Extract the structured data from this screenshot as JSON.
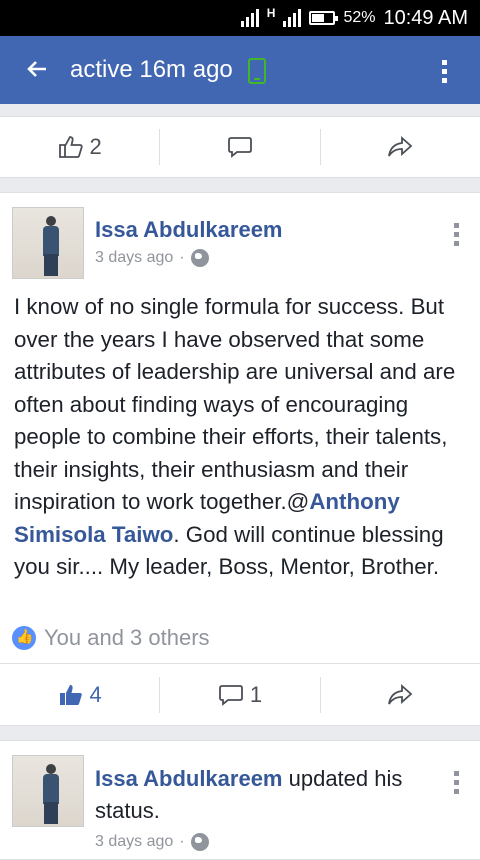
{
  "status_bar": {
    "network": "H",
    "battery": "52%",
    "time": "10:49 AM"
  },
  "app_bar": {
    "title": "active 16m ago"
  },
  "post1": {
    "like_count": "2"
  },
  "post2": {
    "author": "Issa Abdulkareem",
    "time": "3 days ago",
    "text_before_mention": "I know of no single formula for success. But over the years I have observed that some attributes of leadership are universal and are often about finding ways of encouraging people to combine their efforts, their talents, their insights, their enthusiasm and their inspiration to work together.@",
    "mention": "Anthony Simisola Taiwo",
    "text_after_mention": ". God will continue blessing you sir.... My leader, Boss, Mentor, Brother.",
    "reactions": "You and 3 others",
    "like_count": "4",
    "comment_count": "1"
  },
  "post3": {
    "author": "Issa Abdulkareem",
    "action": " updated his status.",
    "time": "3 days ago"
  },
  "colors": {
    "brand": "#4267b2",
    "link": "#365899",
    "liked": "#4267b2",
    "online": "#42b72a"
  }
}
